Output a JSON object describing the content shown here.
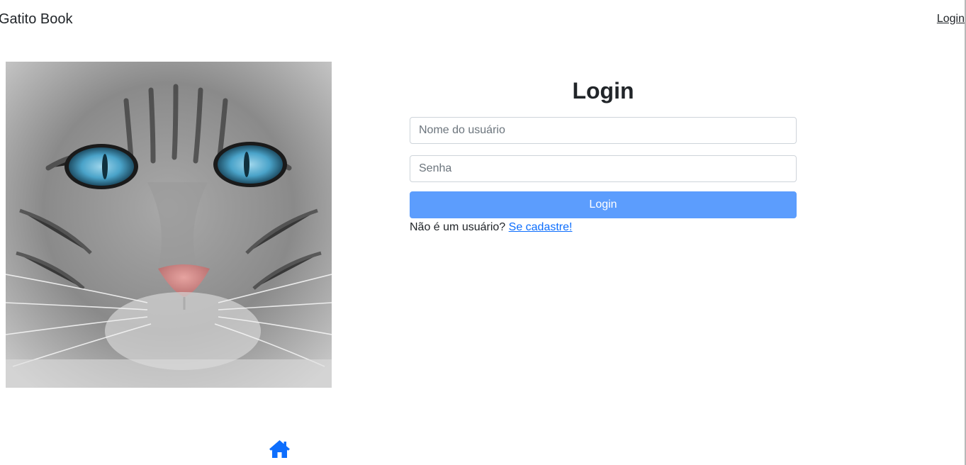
{
  "navbar": {
    "brand": "Gatito Book",
    "login_link": "Login"
  },
  "login_form": {
    "title": "Login",
    "username_placeholder": "Nome do usuário",
    "password_placeholder": "Senha",
    "submit_label": "Login",
    "register_prompt": "Não é um usuário?",
    "register_link": "Se cadastre!"
  },
  "footer": {
    "home_icon": "home-icon"
  },
  "colors": {
    "button": "#5c9dfd",
    "link": "#0d6efd",
    "home_icon": "#0d6efd",
    "text": "#212529",
    "input_border": "#ced4da"
  }
}
